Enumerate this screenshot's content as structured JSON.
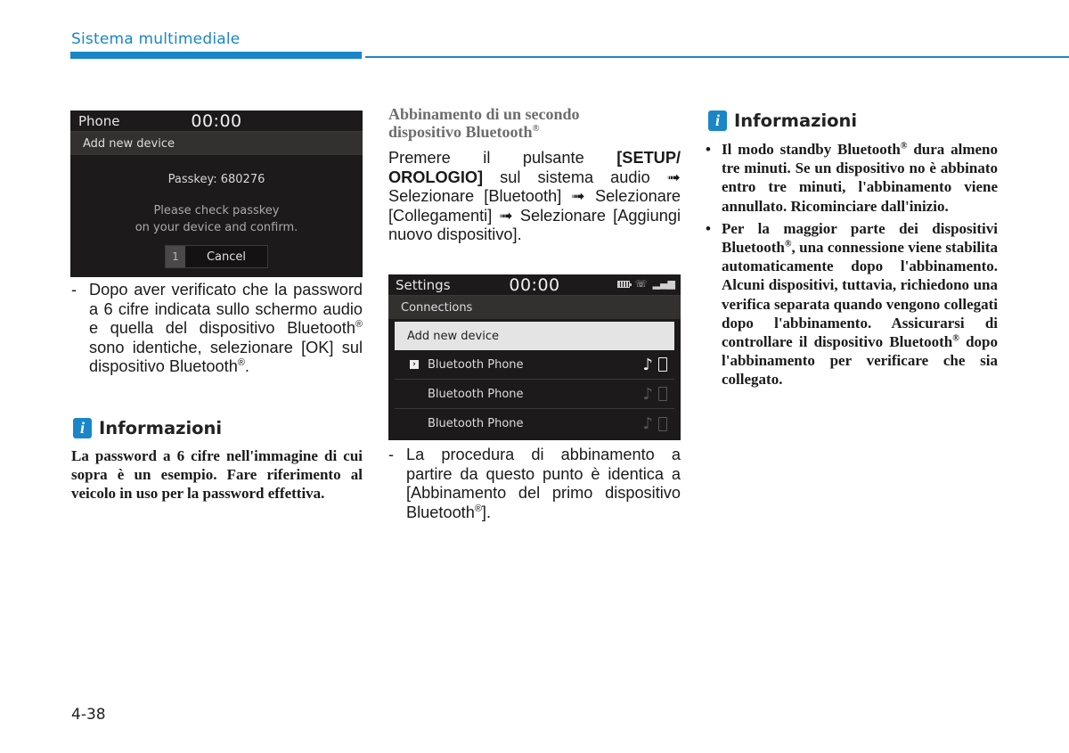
{
  "header": {
    "section_title": "Sistema multimediale",
    "accent_color": "#1a86c8"
  },
  "footer": {
    "page_number": "4-38"
  },
  "screen1": {
    "app_name": "Phone",
    "clock": "00:00",
    "subtitle": "Add new device",
    "passkey": "Passkey: 680276",
    "message_line1": "Please check passkey",
    "message_line2": "on your device and confirm.",
    "button_number": "1",
    "button_label": "Cancel"
  },
  "col1": {
    "dash": "-",
    "paragraph_parts": [
      "Dopo aver verificato che la password a 6 cifre indicata sullo schermo audio e quella del dispositivo Bluetooth",
      "®",
      " sono identiche, selezionare [OK] sul dispositivo Bluetooth",
      "®",
      "."
    ],
    "info": {
      "icon": "i",
      "title": "Informazioni",
      "text": "La password a 6 cifre nell'immagine di cui sopra è un esempio. Fare riferimento al veicolo in uso per la password effettiva."
    }
  },
  "col2": {
    "heading_line1": "Abbinamento di un secondo",
    "heading_line2": "dispositivo Bluetooth",
    "heading_reg": "®",
    "instr_prefix": "Premere il pulsante ",
    "instr_bold": "[SETUP/ OROLOGIO]",
    "instr_rest": " sul sistema audio ➟ Selezionare [Bluetooth] ➟ Selezionare [Collegamenti] ➟ Selezionare [Aggiungi nuovo dispositivo].",
    "dash": "-",
    "note_text": "La procedura di abbinamento a partire da questo punto è identica a [Abbinamento del primo dispositivo Bluetooth",
    "note_reg": "®",
    "note_end": "]."
  },
  "screen2": {
    "app_name": "Settings",
    "clock": "00:00",
    "status_icons": [
      "battery-icon",
      "bluetooth-handsfree-icon",
      "signal-strength-icon"
    ],
    "subtitle": "Connections",
    "add_new_device": "Add new device",
    "devices": [
      {
        "name": "Bluetooth Phone",
        "connected": true,
        "arrow": "›"
      },
      {
        "name": "Bluetooth Phone",
        "connected": false
      },
      {
        "name": "Bluetooth Phone",
        "connected": false
      }
    ],
    "note_glyph": "♪"
  },
  "col3": {
    "info": {
      "icon": "i",
      "title": "Informazioni",
      "bullet1_a": "Il modo standby Bluetooth",
      "bullet1_reg": "®",
      "bullet1_b": " dura almeno tre minuti. Se un dispositivo no è abbinato entro tre minuti, l'abbinamento viene annullato. Ricominciare dall'inizio.",
      "bullet2_a": "Per la maggior parte dei dispositivi Bluetooth",
      "bullet2_reg": "®",
      "bullet2_b": ", una connessione viene stabilita automaticamente dopo l'abbinamento. Alcuni dispositivi, tuttavia, richiedono una verifica separata quando vengono collegati dopo l'abbinamento. Assicurarsi di controllare il dispositivo Bluetooth",
      "bullet2_reg2": "®",
      "bullet2_c": " dopo l'abbinamento per verificare che sia collegato."
    }
  }
}
